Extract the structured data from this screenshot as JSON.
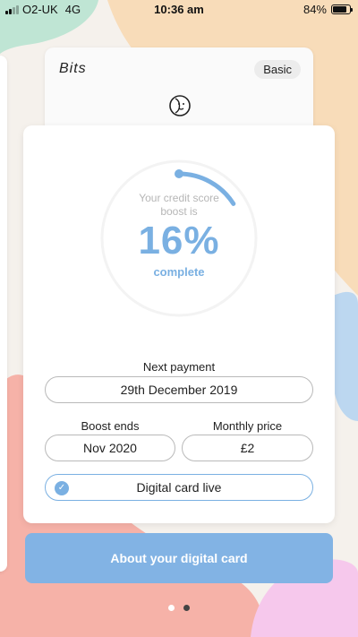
{
  "status_bar": {
    "carrier": "O2-UK",
    "network": "4G",
    "time": "10:36 am",
    "battery_percent": "84%",
    "battery_level": 0.84,
    "signal_bars_active": 2
  },
  "back_card": {
    "title": "Bits",
    "plan_badge": "Basic",
    "icon": "moon-face-icon"
  },
  "progress": {
    "caption": "Your credit score boost is",
    "value_text": "16%",
    "value": 0.16,
    "status": "complete"
  },
  "next_payment": {
    "label": "Next payment",
    "value": "29th December 2019"
  },
  "boost_ends": {
    "label": "Boost ends",
    "value": "Nov 2020"
  },
  "monthly_price": {
    "label": "Monthly price",
    "value": "£2"
  },
  "digital_card": {
    "status": "Digital card live",
    "icon": "check-icon"
  },
  "cta": {
    "label": "About your digital card"
  },
  "pagination": {
    "count": 2,
    "active_index": 1
  },
  "colors": {
    "accent": "#7ab0e2",
    "cta_background": "#82b3e4",
    "background": "#f5f1ec",
    "blob_green": "#bfe5d4",
    "blob_orange": "#f8dcb9",
    "blob_blue": "#bcd7f0",
    "blob_pink": "#f6b2a8"
  }
}
